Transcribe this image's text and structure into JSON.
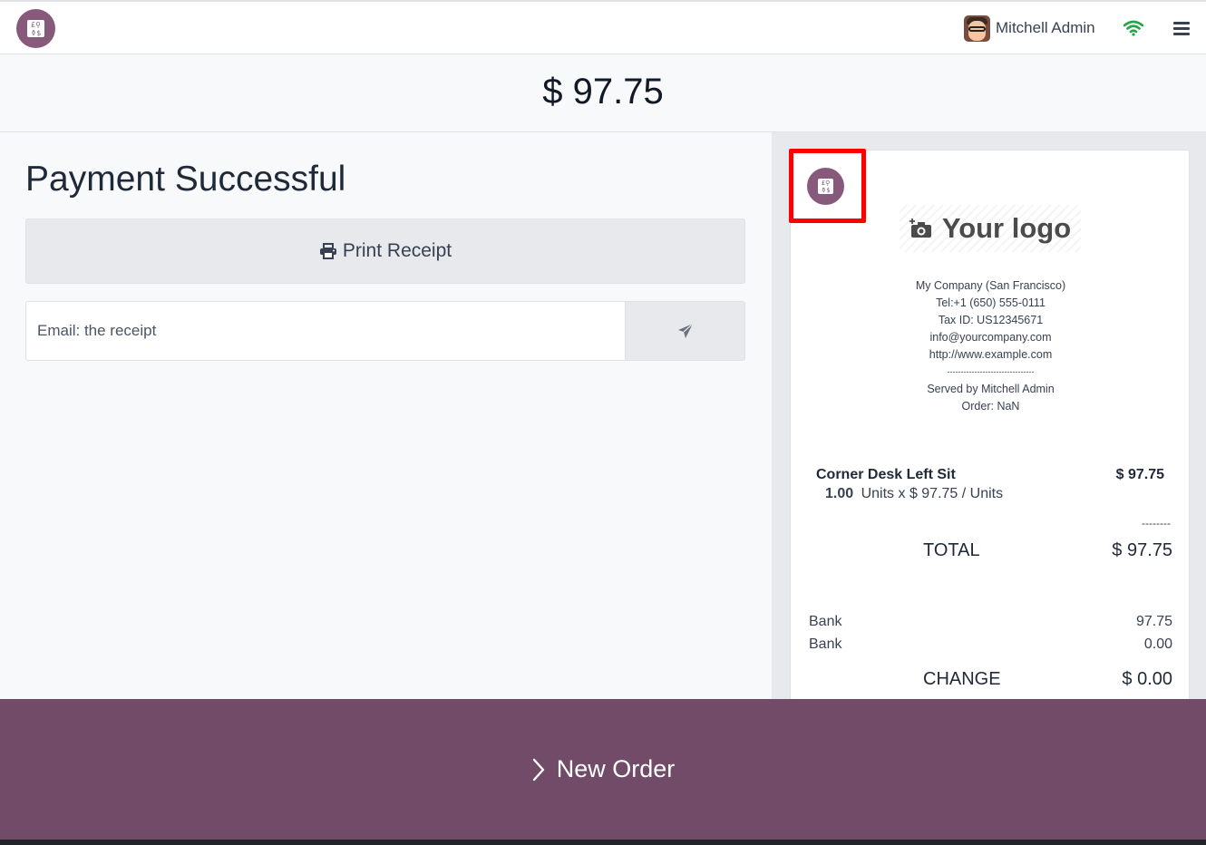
{
  "header": {
    "logo_icon": "odoo-pos-logo-icon",
    "user_name": "Mitchell Admin",
    "connection_icon": "wifi-icon",
    "menu_icon": "hamburger-menu-icon",
    "brand_color": "#714b67",
    "logo_color": "#875a7b",
    "wifi_color": "#22a447"
  },
  "amount_due": "$ 97.75",
  "payment": {
    "title": "Payment Successful",
    "print_label": "Print Receipt",
    "email_placeholder": "Email: the receipt"
  },
  "receipt": {
    "logo_placeholder": "Your logo",
    "company_lines": [
      "My Company (San Francisco)",
      "Tel:+1 (650) 555-0111",
      "Tax ID: US12345671",
      "info@yourcompany.com",
      "http://www.example.com",
      "--------------------------------",
      "Served by Mitchell Admin",
      "Order: NaN"
    ],
    "line": {
      "product": "Corner Desk Left Sit",
      "price": "$ 97.75",
      "qty": "1.00",
      "detail": "Units x $ 97.75 / Units"
    },
    "separator": "--------",
    "total_label": "TOTAL",
    "total_value": "$ 97.75",
    "payments": [
      {
        "method": "Bank",
        "amount": "97.75"
      },
      {
        "method": "Bank",
        "amount": "0.00"
      }
    ],
    "change_label": "CHANGE",
    "change_value": "$ 0.00"
  },
  "footer": {
    "new_order_label": "New Order"
  }
}
